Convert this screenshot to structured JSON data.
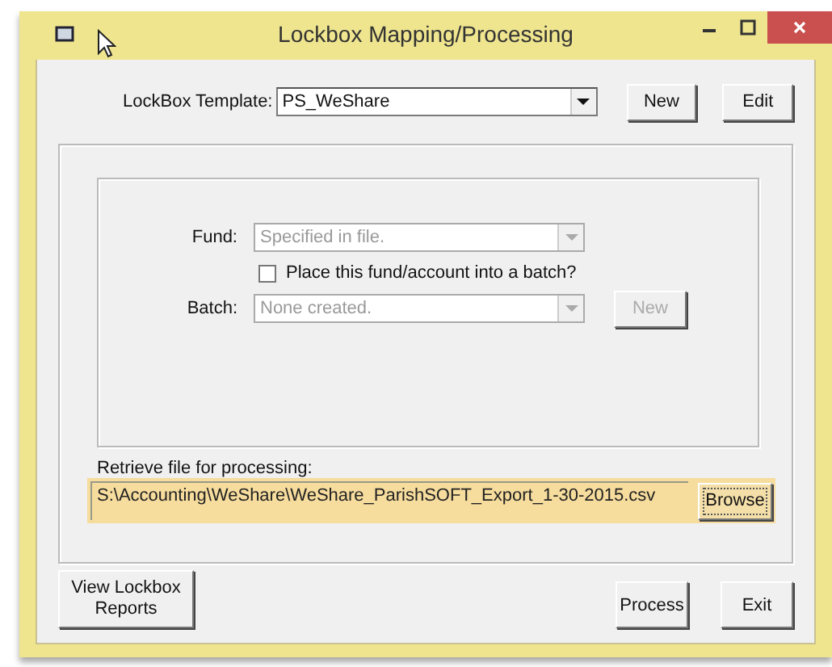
{
  "window": {
    "title": "Lockbox Mapping/Processing"
  },
  "template": {
    "label": "LockBox Template:",
    "value": "PS_WeShare",
    "buttons": [
      {
        "label": "New",
        "disabled": false
      },
      {
        "label": "Edit",
        "disabled": false
      }
    ]
  },
  "fund": {
    "label": "Fund:",
    "value": "Specified in file.",
    "disabled": true
  },
  "batch_checkbox": {
    "label": "Place this fund/account into a batch?",
    "checked": false
  },
  "batch": {
    "label": "Batch:",
    "value": "None created.",
    "disabled": true,
    "button": {
      "label": "New",
      "disabled": true
    }
  },
  "file": {
    "label": "Retrieve file for processing:",
    "value": "S:\\Accounting\\WeShare\\WeShare_ParishSOFT_Export_1-30-2015.csv",
    "highlighted": true,
    "button": {
      "label": "Browse",
      "focused": true
    }
  },
  "footer_buttons": [
    {
      "label": "View Lockbox Reports",
      "kind": "tall"
    },
    {
      "label": "Process",
      "kind": "normal"
    },
    {
      "label": "Exit",
      "kind": "normal"
    }
  ]
}
